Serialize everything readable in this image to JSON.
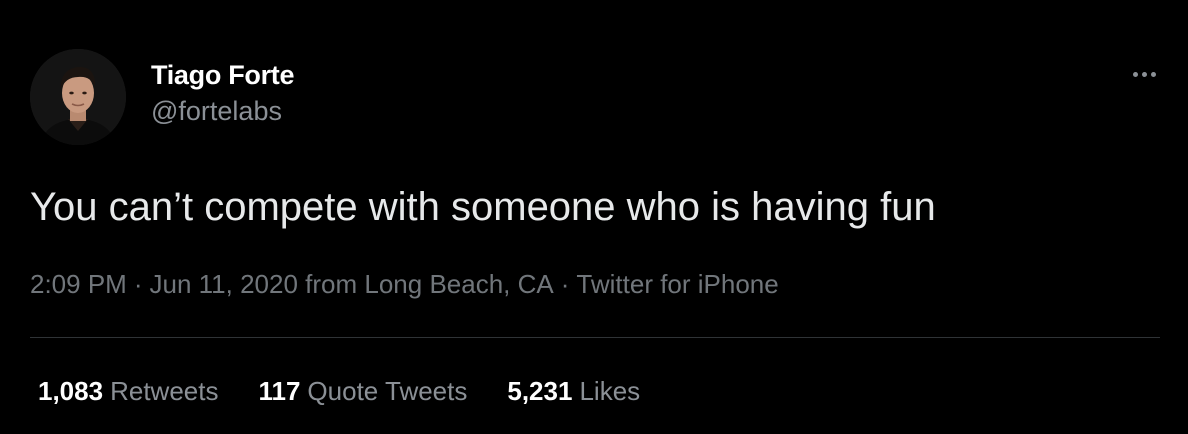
{
  "colors": {
    "background": "#000000",
    "text_primary": "#e7e9ea",
    "text_secondary": "#71767b",
    "divider": "#2f3336"
  },
  "author": {
    "display_name": "Tiago Forte",
    "handle": "@fortelabs",
    "avatar_icon": "person-avatar-icon"
  },
  "more_icon": "more-horizontal-icon",
  "tweet": {
    "text": "You can’t compete with someone who is having fun"
  },
  "meta": {
    "time": "2:09 PM",
    "separator": "·",
    "date": "Jun 11, 2020",
    "location": "from Long Beach, CA",
    "source": "Twitter for iPhone"
  },
  "stats": {
    "retweets": {
      "count": "1,083",
      "label": "Retweets"
    },
    "quote_tweets": {
      "count": "117",
      "label": "Quote Tweets"
    },
    "likes": {
      "count": "5,231",
      "label": "Likes"
    }
  }
}
